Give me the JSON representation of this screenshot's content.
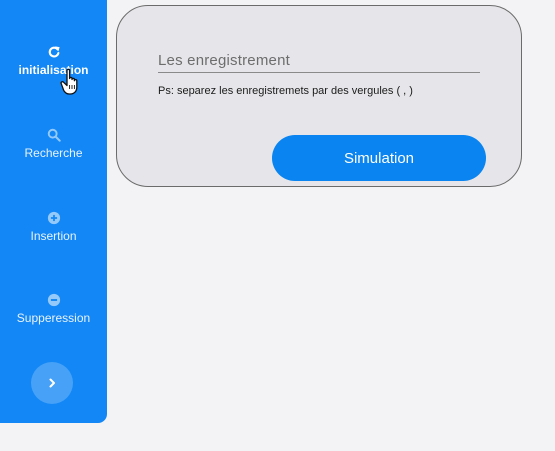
{
  "sidebar": {
    "items": [
      {
        "label": "initialisation",
        "icon": "refresh-icon"
      },
      {
        "label": "Recherche",
        "icon": "search-icon"
      },
      {
        "label": "Insertion",
        "icon": "plus-circle-icon"
      },
      {
        "label": "Supperession",
        "icon": "minus-circle-icon"
      }
    ],
    "expand_icon": "chevron-right-icon"
  },
  "form": {
    "input_placeholder": "Les enregistrement",
    "hint": "Ps: separez les enregistremets par des vergules ( , )",
    "simulate_label": "Simulation"
  },
  "colors": {
    "sidebar_bg": "#1287f5",
    "card_bg": "#e6e6ea",
    "primary_button": "#0a84f0",
    "page_bg": "#f3f3f5"
  }
}
